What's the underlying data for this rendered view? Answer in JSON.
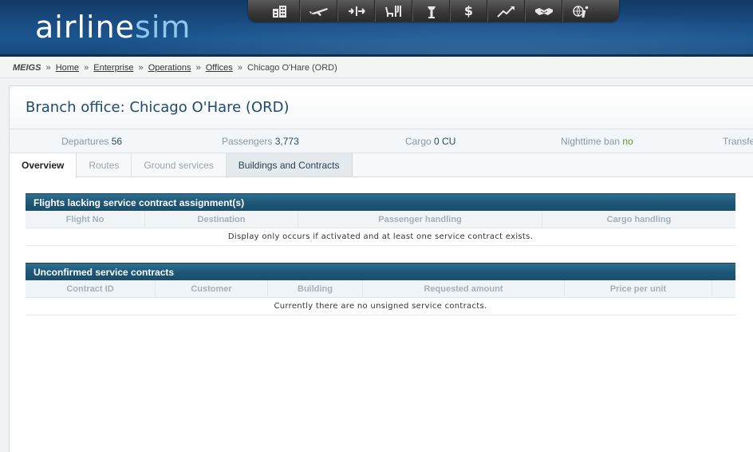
{
  "header": {
    "logo_main": "airline",
    "logo_accent": "sim",
    "nav_icons": [
      "buildings-icon",
      "airplane-icon",
      "route-icon",
      "service-icon",
      "tower-icon",
      "dollar-icon",
      "chart-icon",
      "handshake-icon",
      "info-icon"
    ],
    "dollar_glyph": "$"
  },
  "breadcrumb": {
    "root": "MEIGS",
    "sep": "»",
    "links": [
      "Home",
      "Enterprise",
      "Operations",
      "Offices"
    ],
    "current": "Chicago O'Hare (ORD)"
  },
  "page": {
    "title": "Branch office: Chicago O'Hare (ORD)"
  },
  "stats": {
    "departures_label": "Departures",
    "departures_value": "56",
    "passengers_label": "Passengers",
    "passengers_value": "3,773",
    "cargo_label": "Cargo",
    "cargo_value": "0 CU",
    "nighttime_label": "Nighttime ban",
    "nighttime_value": "no",
    "transfer_label": "Transfers"
  },
  "tabs": [
    {
      "label": "Overview"
    },
    {
      "label": "Routes"
    },
    {
      "label": "Ground services"
    },
    {
      "label": "Buildings and Contracts"
    }
  ],
  "section1": {
    "title": "Flights lacking service contract assignment(s)",
    "columns": [
      "Flight No",
      "Destination",
      "Passenger handling",
      "Cargo handling"
    ],
    "empty_message": "Display only occurs if activated and at least one service contract exists."
  },
  "section2": {
    "title": "Unconfirmed service contracts",
    "columns": [
      "Contract ID",
      "Customer",
      "Building",
      "Requested amount",
      "Price per unit",
      ""
    ],
    "empty_message": "Currently there are no unsigned service contracts."
  },
  "colors": {
    "header_blue": "#1a4f86",
    "section_head": "#1d5676",
    "title_text": "#1d4a6d",
    "nighttime_no": "#5c9a18"
  }
}
